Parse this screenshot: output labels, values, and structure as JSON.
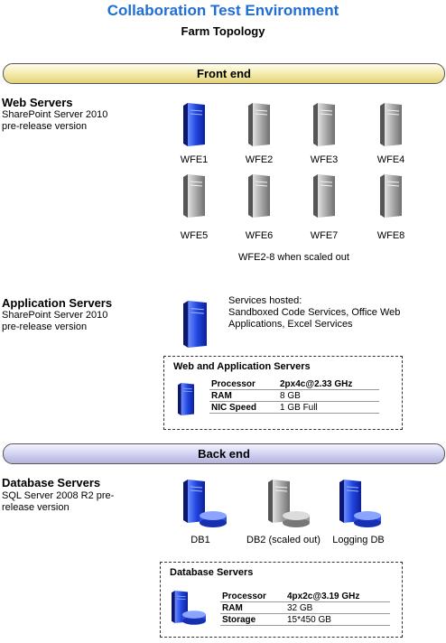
{
  "title": "Collaboration Test Environment",
  "subtitle": "Farm Topology",
  "front_band": "Front end",
  "back_band": "Back end",
  "web": {
    "title": "Web Servers",
    "desc": [
      "SharePoint Server 2010",
      "pre-release version"
    ],
    "servers": [
      "WFE1",
      "WFE2",
      "WFE3",
      "WFE4",
      "WFE5",
      "WFE6",
      "WFE7",
      "WFE8"
    ],
    "note": "WFE2-8 when scaled out"
  },
  "app": {
    "title": "Application Servers",
    "desc": [
      "SharePoint Server 2010",
      "pre-release version"
    ],
    "services": [
      "Services hosted:",
      "Sandboxed Code Services, Office Web",
      "Applications, Excel Services"
    ]
  },
  "webapp_box": {
    "title": "Web and Application Servers",
    "specs": [
      {
        "key": "Processor",
        "value": "2px4c@2.33 GHz"
      },
      {
        "key": "RAM",
        "value": "8 GB"
      },
      {
        "key": "NIC Speed",
        "value": "1 GB Full"
      }
    ]
  },
  "db": {
    "title": "Database Servers",
    "desc": [
      "SQL Server 2008 R2 pre-",
      "release version"
    ],
    "servers": [
      "DB1",
      "DB2 (scaled out)",
      "Logging DB"
    ]
  },
  "db_box": {
    "title": "Database Servers",
    "specs": [
      {
        "key": "Processor",
        "value": "4px2c@3.19  GHz"
      },
      {
        "key": "RAM",
        "value": "32 GB"
      },
      {
        "key": "Storage",
        "value": "15*450 GB"
      }
    ]
  },
  "colors": {
    "title": "#1f6ed4",
    "active_server": "#1c3fd0",
    "inactive_server": "#8c8c8c",
    "front_band": "#f3e9a6",
    "back_band": "#cfcff0"
  }
}
